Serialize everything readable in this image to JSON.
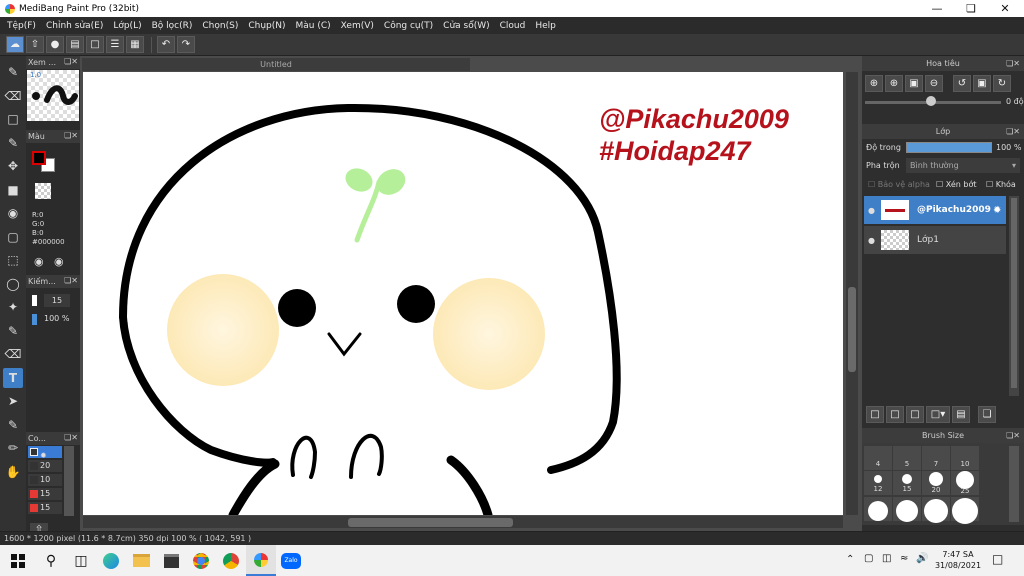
{
  "window": {
    "title": "MediBang Paint Pro (32bit)"
  },
  "menu": [
    "Tệp(F)",
    "Chỉnh sửa(E)",
    "Lớp(L)",
    "Bộ lọc(R)",
    "Chọn(S)",
    "Chụp(N)",
    "Màu (C)",
    "Xem(V)",
    "Công cụ(T)",
    "Cửa sổ(W)",
    "Cloud",
    "Help"
  ],
  "document": {
    "tab_title": "Untitled"
  },
  "canvas_text": {
    "line1": "@Pikachu2009",
    "line2": "#Hoidap247"
  },
  "left_panels": {
    "view": {
      "title": "Xem ...",
      "zoom": "1.0"
    },
    "color": {
      "title": "Màu",
      "r": "R:0",
      "g": "G:0",
      "b": "B:0",
      "hex": "#000000",
      "primary": "#000000"
    },
    "brush": {
      "title": "Kiếm...",
      "size": "15",
      "opacity": "100 %"
    },
    "brushlist": {
      "title": "Co...",
      "items": [
        "20",
        "10",
        "15",
        "15"
      ]
    }
  },
  "navigator": {
    "title": "Hoa tiêu",
    "angle": "0 độ"
  },
  "layer_panel": {
    "title": "Lớp",
    "opacity_label": "Độ trong",
    "opacity_value": "100 %",
    "blend_label": "Pha trộn",
    "blend_value": "Bình thường",
    "protect_alpha": "Bảo vệ alpha",
    "clipping": "Xén bớt",
    "lock": "Khóa",
    "layers": [
      {
        "name": "@Pikachu2009",
        "selected": true
      },
      {
        "name": "Lớp1",
        "selected": false
      }
    ]
  },
  "brush_size": {
    "title": "Brush Size",
    "labels": [
      "4",
      "5",
      "7",
      "10",
      "12",
      "15",
      "20",
      "25"
    ]
  },
  "status": {
    "text": "1600 * 1200 pixel   (11.6 * 8.7cm)   350 dpi   100 %   ( 1042, 591 )"
  },
  "taskbar": {
    "time": "7:47 SA",
    "date": "31/08/2021",
    "zalo": "Zalo"
  },
  "colors": {
    "accent": "#3f7fc8",
    "canvas_text": "#b5121b",
    "sprout": "#b6ef9a",
    "cheek": "#fde9b7"
  }
}
